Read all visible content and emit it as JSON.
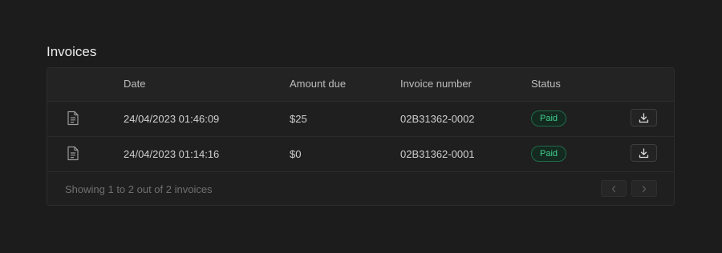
{
  "section": {
    "title": "Invoices"
  },
  "table": {
    "headers": {
      "date": "Date",
      "amount": "Amount due",
      "invoice": "Invoice number",
      "status": "Status"
    },
    "rows": [
      {
        "date": "24/04/2023 01:46:09",
        "amount": "$25",
        "invoice": "02B31362-0002",
        "status": "Paid"
      },
      {
        "date": "24/04/2023 01:14:16",
        "amount": "$0",
        "invoice": "02B31362-0001",
        "status": "Paid"
      }
    ],
    "footer": "Showing 1 to 2 out of 2 invoices"
  },
  "icons": {
    "row_icon": "document-icon",
    "action_icon": "download-icon",
    "prev_icon": "chevron-left-icon",
    "next_icon": "chevron-right-icon"
  },
  "colors": {
    "background": "#1c1c1c",
    "status_paid": "#3ecf8e"
  }
}
